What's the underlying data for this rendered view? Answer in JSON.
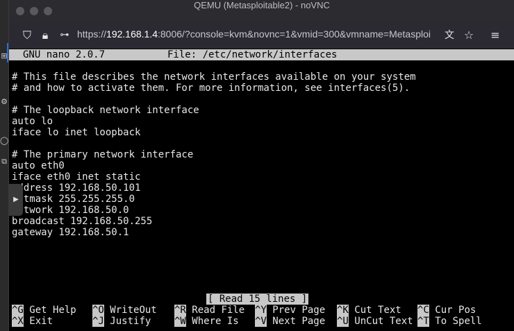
{
  "window": {
    "title": "QEMU (Metasploitable2) - noVNC"
  },
  "browser": {
    "url_prefix": "https://",
    "url_host": "192.168.1.4",
    "url_rest": ":8006/?console=kvm&novnc=1&vmid=300&vmname=Metasploi",
    "icons": [
      "shield-icon",
      "lock-icon",
      "permissions-icon",
      "translate-icon",
      "bookmark-star-icon",
      "menu-icon"
    ]
  },
  "nano": {
    "header_app": "GNU nano 2.0.7",
    "header_file": "File: /etc/network/interfaces",
    "status": "[ Read 15 lines ]",
    "lines": [
      "# This file describes the network interfaces available on your system",
      "# and how to activate them. For more information, see interfaces(5).",
      "",
      "# The loopback network interface",
      "auto lo",
      "iface lo inet loopback",
      "",
      "# The primary network interface",
      "auto eth0",
      "iface eth0 inet static",
      "address 192.168.50.101",
      "netmask 255.255.255.0",
      "network 192.168.50.0",
      "broadcast 192.168.50.255",
      "gateway 192.168.50.1"
    ],
    "shortcuts": [
      {
        "key": "^G",
        "label": "Get Help"
      },
      {
        "key": "^O",
        "label": "WriteOut"
      },
      {
        "key": "^R",
        "label": "Read File"
      },
      {
        "key": "^Y",
        "label": "Prev Page"
      },
      {
        "key": "^K",
        "label": "Cut Text"
      },
      {
        "key": "^C",
        "label": "Cur Pos"
      },
      {
        "key": "^X",
        "label": "Exit"
      },
      {
        "key": "^J",
        "label": "Justify"
      },
      {
        "key": "^W",
        "label": "Where Is"
      },
      {
        "key": "^V",
        "label": "Next Page"
      },
      {
        "key": "^U",
        "label": "UnCut Text"
      },
      {
        "key": "^T",
        "label": "To Spell"
      }
    ]
  },
  "colors": {
    "terminal_bg": "#000000",
    "terminal_fg": "#e8e8e8",
    "inverse_bg": "#c8c8c8",
    "toolbar_bg": "#2b2a33"
  }
}
